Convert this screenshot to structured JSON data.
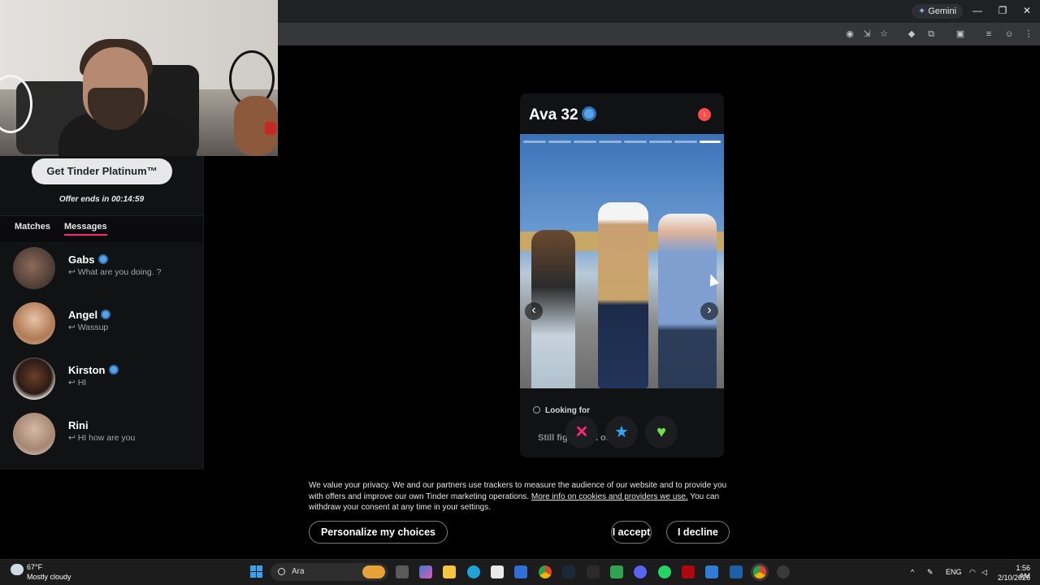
{
  "browser": {
    "gemini_label": "Gemini"
  },
  "sidebar": {
    "platinum_button": "Get Tinder Platinum™",
    "offer": "Offer ends in 00:14:59",
    "tabs": [
      {
        "label": "Matches"
      },
      {
        "label": "Messages"
      }
    ],
    "active_tab": "Messages",
    "messages": [
      {
        "name": "Gabs",
        "preview": "↩ What are you doing. ?"
      },
      {
        "name": "Angel",
        "preview": "↩ Wassup"
      },
      {
        "name": "Kirston",
        "preview": "↩ HI"
      },
      {
        "name": "Rini",
        "preview": "↩ HI how are you"
      }
    ]
  },
  "profile": {
    "name_age": "Ava 32",
    "photo_count": 8,
    "photo_index": 8,
    "looking_label": "Looking for",
    "looking_value": "Still figuring it out",
    "actions": {
      "nope": "✕",
      "super": "★",
      "like": "♥"
    }
  },
  "consent": {
    "text_before": "We value your privacy. We and our partners use trackers to measure the audience of our website and to provide you with offers and improve our own Tinder marketing operations.",
    "link": "More info on cookies and providers we use.",
    "text_after": "You can withdraw your consent at any time in your settings.",
    "personalize": "Personalize my choices",
    "accept": "I accept",
    "decline": "I decline"
  },
  "taskbar": {
    "weather_temp": "67°F",
    "weather_cond": "Mostly cloudy",
    "search_text": "Ara",
    "lang": "ENG",
    "time": "1:56 AM",
    "date": "2/10/2026"
  },
  "colors": {
    "accent": "#fd267a",
    "verified": "#5aa3e6",
    "like": "#6ee24b",
    "super": "#2fa8f3"
  }
}
